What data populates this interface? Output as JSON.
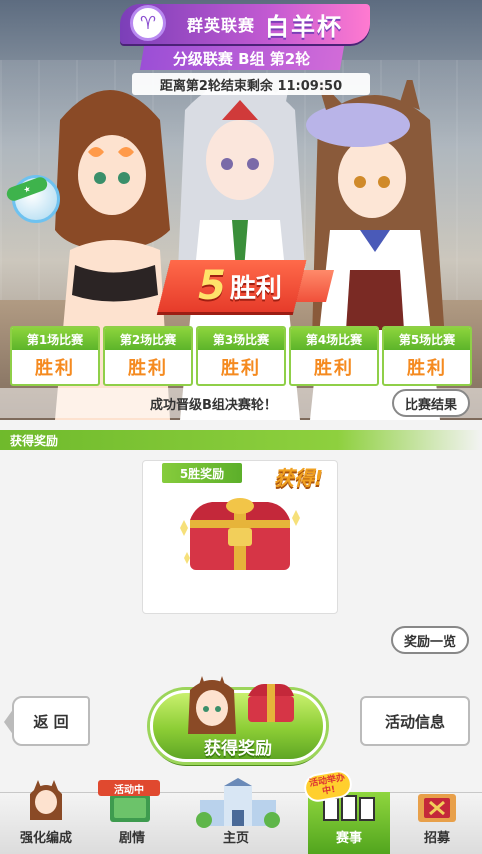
{
  "header": {
    "title": "群英联赛",
    "cup": "白羊杯",
    "subtitle": "分级联赛 B组 第2轮",
    "countdown": "距离第2轮结束剩余 11:09:50"
  },
  "wins": {
    "count": "5",
    "word": "胜利"
  },
  "results": [
    {
      "label": "第1场比赛",
      "value": "胜利"
    },
    {
      "label": "第2场比赛",
      "value": "胜利"
    },
    {
      "label": "第3场比赛",
      "value": "胜利"
    },
    {
      "label": "第4场比赛",
      "value": "胜利"
    },
    {
      "label": "第5场比赛",
      "value": "胜利"
    }
  ],
  "advance_text": "成功晋级B组决赛轮！",
  "results_button": "比赛结果",
  "rewards": {
    "section_title": "获得奖励",
    "card_title": "5胜奖励",
    "obtained": "获得!",
    "list_button": "奖励一览"
  },
  "actions": {
    "back": "返 回",
    "claim": "获得奖励",
    "info": "活动信息"
  },
  "nav": {
    "items": [
      {
        "label": "强化编成"
      },
      {
        "label": "剧情",
        "badge": "活动中"
      },
      {
        "label": "主页"
      },
      {
        "label": "赛事",
        "badge": "活动举办中!"
      },
      {
        "label": "招募"
      }
    ]
  },
  "colors": {
    "accent_green": "#8ccd35",
    "win_orange": "#f58a1f",
    "banner_purple": "#9b4fd6",
    "wins_red": "#e63b2a"
  }
}
